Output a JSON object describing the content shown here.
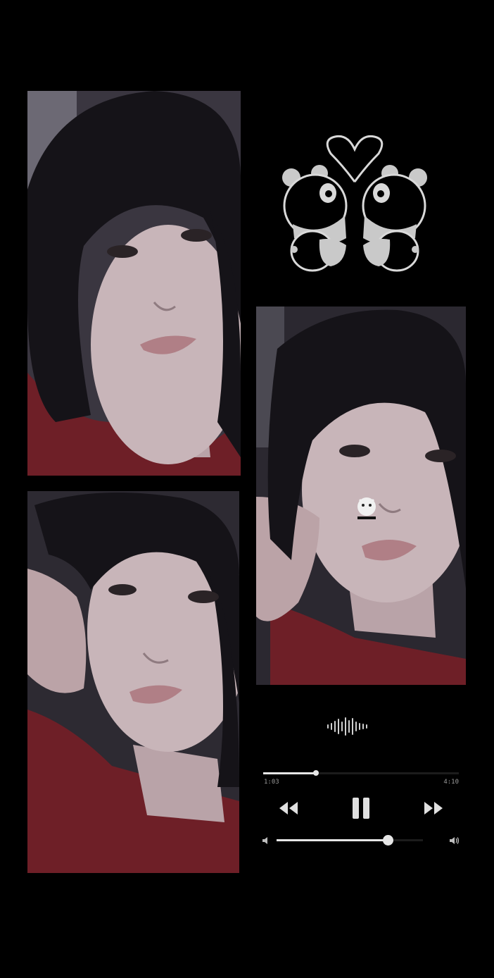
{
  "photos": [
    {
      "id": "photo-1",
      "description_icon": "selfie-photo"
    },
    {
      "id": "photo-2",
      "description_icon": "selfie-photo"
    },
    {
      "id": "photo-3",
      "description_icon": "selfie-photo"
    }
  ],
  "stickers": {
    "pandas": "kissing-pandas-heart-icon",
    "cat": "cat-sticker-icon"
  },
  "player": {
    "time_elapsed": "1:03",
    "time_total": "4:10",
    "progress": 0.27,
    "volume": 0.76,
    "icons": {
      "waveform": "waveform-icon",
      "rewind": "rewind-icon",
      "pause": "pause-icon",
      "forward": "fast-forward-icon",
      "volume_low": "volume-low-icon",
      "volume_high": "volume-high-icon"
    }
  },
  "colors": {
    "background": "#000000",
    "shirt": "#6e1f27",
    "skin": "#c9b6ba",
    "hair": "#151318",
    "player_fg": "#e6e6e6"
  }
}
